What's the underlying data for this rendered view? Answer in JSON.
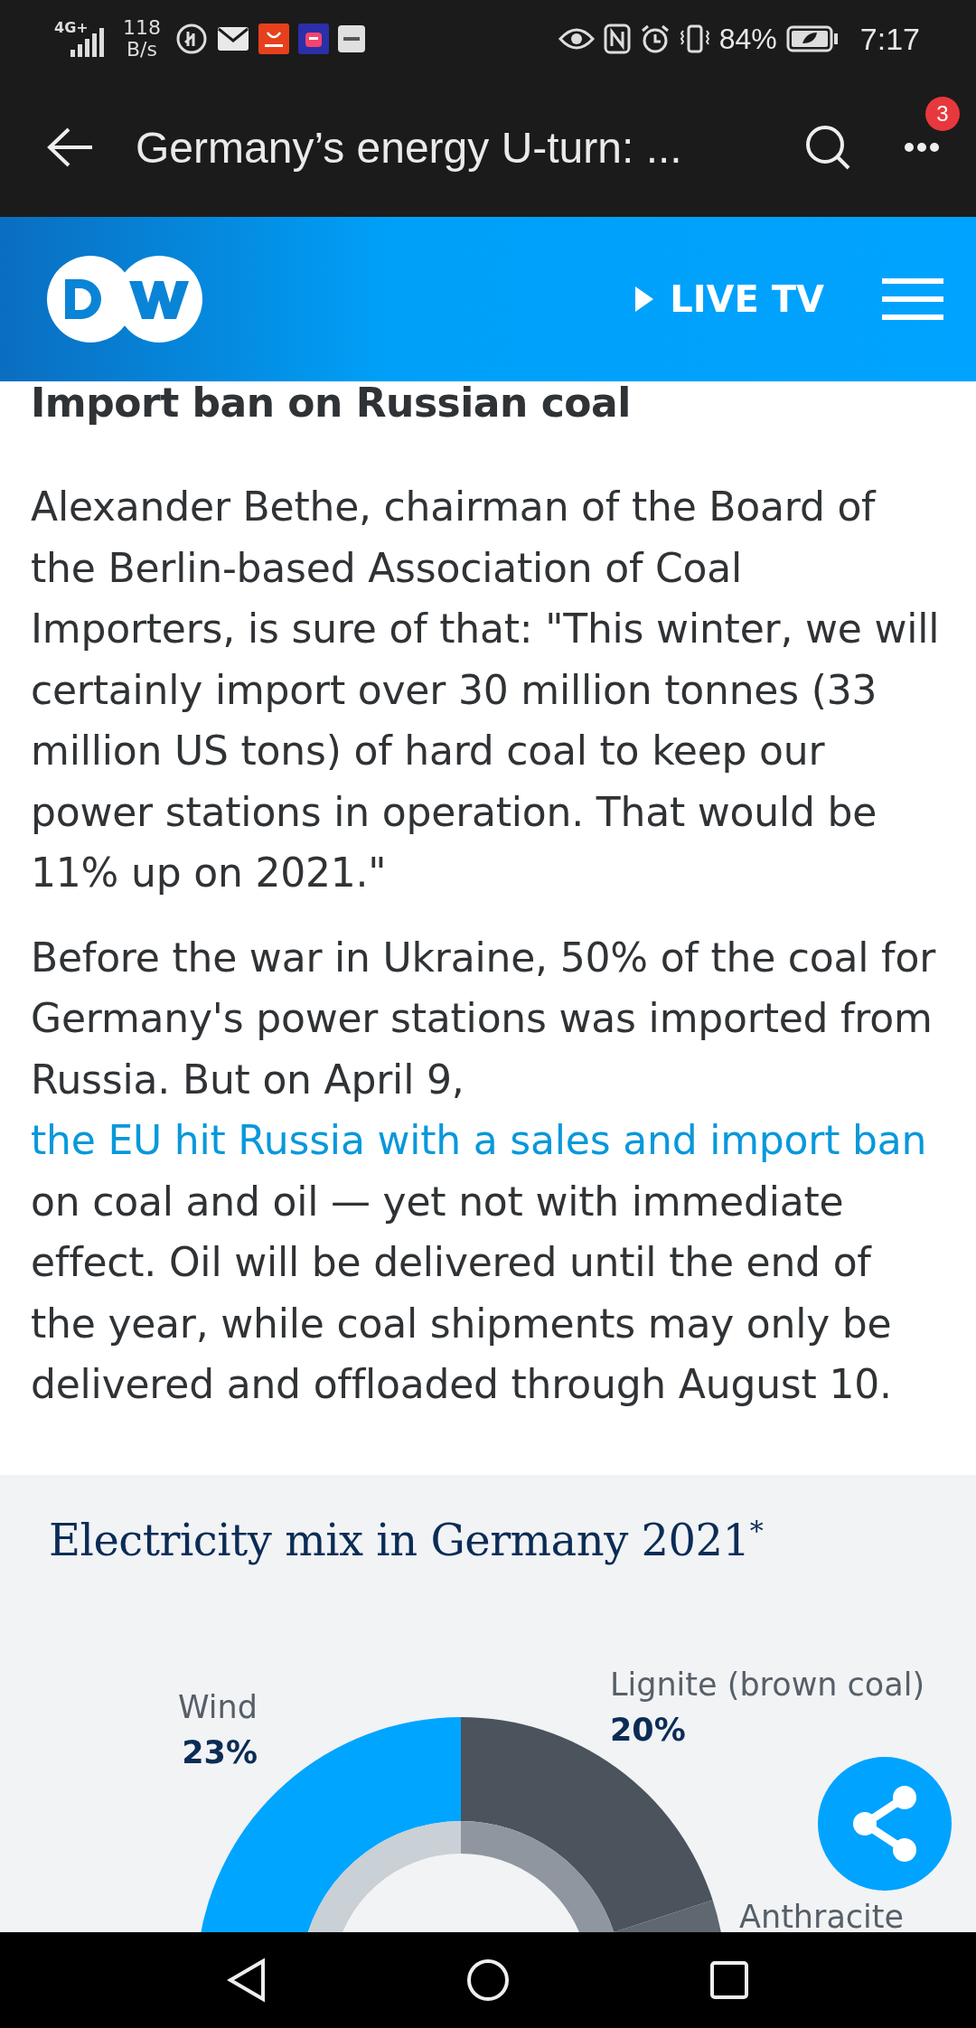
{
  "status_bar": {
    "network": "4G+",
    "speed_value": "118",
    "speed_unit": "B/s",
    "battery": "84%",
    "time": "7:17"
  },
  "app_bar": {
    "title": "Germany’s energy U-turn: ...",
    "menu_badge": "3"
  },
  "site_header": {
    "live_label": "LIVE TV"
  },
  "article": {
    "heading": "Import ban on Russian coal",
    "paragraphs": [
      [
        {
          "kind": "text",
          "text": "Alexander Bethe, chairman of the Board of the Berlin-based Association of Coal Importers, is sure of that: \"This winter, we will certainly import over 30 million tonnes (33 million US tons) of hard coal to keep our power stations in operation. That would be 11% up on 2021.\""
        }
      ],
      [
        {
          "kind": "text",
          "text": "Before the war in Ukraine, 50% of the coal for Germany's power stations was imported from Russia. But on April 9, "
        },
        {
          "kind": "link",
          "text": "the EU hit Russia with a sales and import ban"
        },
        {
          "kind": "text",
          "text": " on coal and oil — yet not with immediate effect. Oil will be delivered until the end of the year, while coal shipments may only be delivered and offloaded through August 10."
        }
      ]
    ]
  },
  "infographic": {
    "title": "Electricity mix in Germany 2021$^{*}$",
    "slices": [
      {
        "label": "Wind",
        "value": "23%",
        "color": "#00a5ff"
      },
      {
        "label": "Lignite (brown coal)",
        "value": "20%",
        "color": "#4b535d"
      },
      {
        "label": "Anthracite",
        "color": "#5f6770"
      }
    ]
  }
}
